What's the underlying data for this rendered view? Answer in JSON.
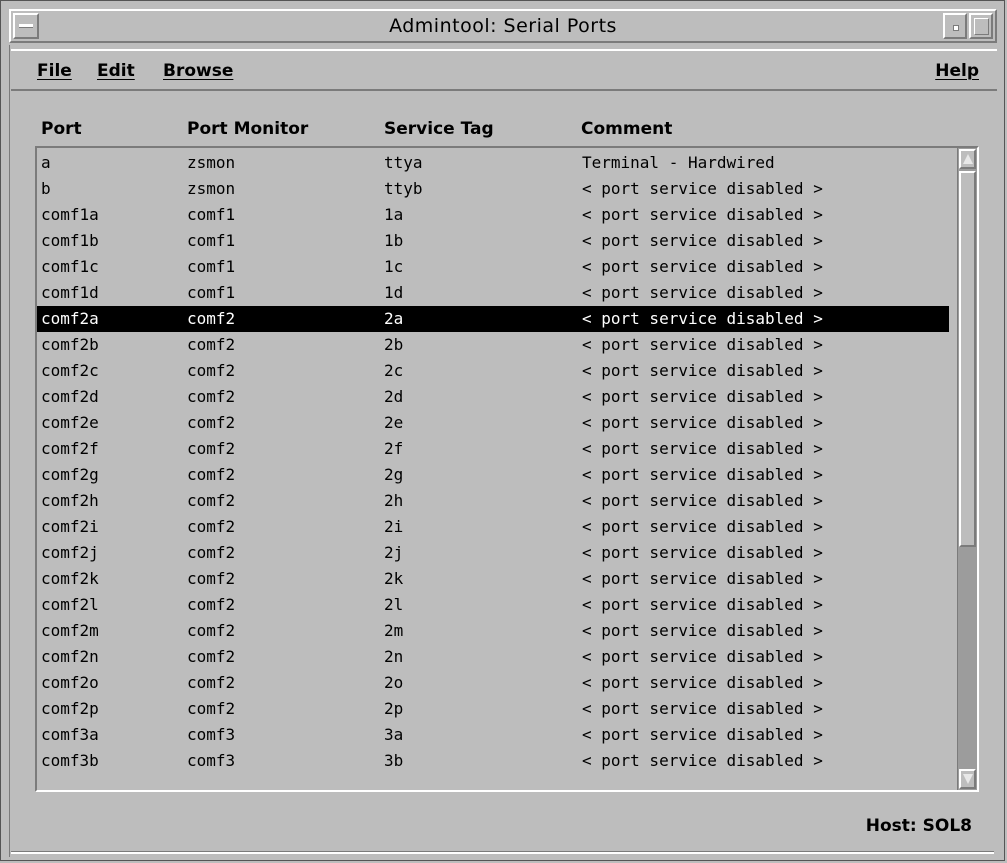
{
  "window": {
    "title": "Admintool: Serial Ports"
  },
  "menu": {
    "file": "File",
    "edit": "Edit",
    "browse": "Browse",
    "help": "Help"
  },
  "columns": {
    "port": "Port",
    "monitor": "Port Monitor",
    "tag": "Service Tag",
    "comment": "Comment"
  },
  "rows": [
    {
      "port": "a",
      "monitor": "zsmon",
      "tag": "ttya",
      "comment": "Terminal - Hardwired"
    },
    {
      "port": "b",
      "monitor": "zsmon",
      "tag": "ttyb",
      "comment": "< port service disabled >"
    },
    {
      "port": "comf1a",
      "monitor": "comf1",
      "tag": "1a",
      "comment": "< port service disabled >"
    },
    {
      "port": "comf1b",
      "monitor": "comf1",
      "tag": "1b",
      "comment": "< port service disabled >"
    },
    {
      "port": "comf1c",
      "monitor": "comf1",
      "tag": "1c",
      "comment": "< port service disabled >"
    },
    {
      "port": "comf1d",
      "monitor": "comf1",
      "tag": "1d",
      "comment": "< port service disabled >"
    },
    {
      "port": "comf2a",
      "monitor": "comf2",
      "tag": "2a",
      "comment": "< port service disabled >"
    },
    {
      "port": "comf2b",
      "monitor": "comf2",
      "tag": "2b",
      "comment": "< port service disabled >"
    },
    {
      "port": "comf2c",
      "monitor": "comf2",
      "tag": "2c",
      "comment": "< port service disabled >"
    },
    {
      "port": "comf2d",
      "monitor": "comf2",
      "tag": "2d",
      "comment": "< port service disabled >"
    },
    {
      "port": "comf2e",
      "monitor": "comf2",
      "tag": "2e",
      "comment": "< port service disabled >"
    },
    {
      "port": "comf2f",
      "monitor": "comf2",
      "tag": "2f",
      "comment": "< port service disabled >"
    },
    {
      "port": "comf2g",
      "monitor": "comf2",
      "tag": "2g",
      "comment": "< port service disabled >"
    },
    {
      "port": "comf2h",
      "monitor": "comf2",
      "tag": "2h",
      "comment": "< port service disabled >"
    },
    {
      "port": "comf2i",
      "monitor": "comf2",
      "tag": "2i",
      "comment": "< port service disabled >"
    },
    {
      "port": "comf2j",
      "monitor": "comf2",
      "tag": "2j",
      "comment": "< port service disabled >"
    },
    {
      "port": "comf2k",
      "monitor": "comf2",
      "tag": "2k",
      "comment": "< port service disabled >"
    },
    {
      "port": "comf2l",
      "monitor": "comf2",
      "tag": "2l",
      "comment": "< port service disabled >"
    },
    {
      "port": "comf2m",
      "monitor": "comf2",
      "tag": "2m",
      "comment": "< port service disabled >"
    },
    {
      "port": "comf2n",
      "monitor": "comf2",
      "tag": "2n",
      "comment": "< port service disabled >"
    },
    {
      "port": "comf2o",
      "monitor": "comf2",
      "tag": "2o",
      "comment": "< port service disabled >"
    },
    {
      "port": "comf2p",
      "monitor": "comf2",
      "tag": "2p",
      "comment": "< port service disabled >"
    },
    {
      "port": "comf3a",
      "monitor": "comf3",
      "tag": "3a",
      "comment": "< port service disabled >"
    },
    {
      "port": "comf3b",
      "monitor": "comf3",
      "tag": "3b",
      "comment": "< port service disabled >"
    }
  ],
  "selected_port": "comf2a",
  "host_label": "Host: SOL8",
  "colors": {
    "background": "#bdbdbd",
    "selection": "#000000",
    "selection_text": "#ffffff"
  }
}
